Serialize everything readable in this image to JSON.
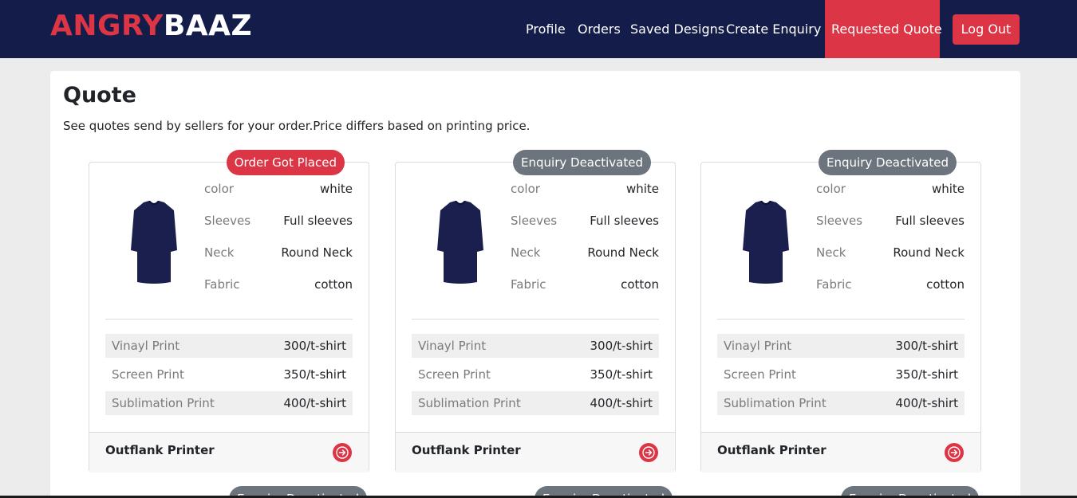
{
  "brand": {
    "part1": "ANGRY",
    "part2": "BAAZ"
  },
  "nav": {
    "profile": "Profile",
    "orders": "Orders",
    "saved_designs": "Saved Designs",
    "create_enquiry": "Create Enquiry",
    "requested_quote": "Requested Quote",
    "logout": "Log Out"
  },
  "page": {
    "title": "Quote",
    "subtitle": "See quotes send by sellers for your order.Price differs based on printing price."
  },
  "colors": {
    "navbar": "#141d4a",
    "accent": "#dc3545",
    "badge_gray": "#6c757d"
  },
  "cards": [
    {
      "status": "Order Got Placed",
      "status_color": "#dc3545",
      "specs": [
        {
          "label": "color",
          "value": "white"
        },
        {
          "label": "Sleeves",
          "value": "Full sleeves"
        },
        {
          "label": "Neck",
          "value": "Round Neck"
        },
        {
          "label": "Fabric",
          "value": "cotton"
        }
      ],
      "prices": [
        {
          "label": "Vinayl Print",
          "value": "300/t-shirt"
        },
        {
          "label": "Screen Print",
          "value": "350/t-shirt"
        },
        {
          "label": "Sublimation Print",
          "value": "400/t-shirt"
        }
      ],
      "seller": "Outflank Printer"
    },
    {
      "status": "Enquiry Deactivated",
      "status_color": "#6c757d",
      "specs": [
        {
          "label": "color",
          "value": "white"
        },
        {
          "label": "Sleeves",
          "value": "Full sleeves"
        },
        {
          "label": "Neck",
          "value": "Round Neck"
        },
        {
          "label": "Fabric",
          "value": "cotton"
        }
      ],
      "prices": [
        {
          "label": "Vinayl Print",
          "value": "300/t-shirt"
        },
        {
          "label": "Screen Print",
          "value": "350/t-shirt"
        },
        {
          "label": "Sublimation Print",
          "value": "400/t-shirt"
        }
      ],
      "seller": "Outflank Printer"
    },
    {
      "status": "Enquiry Deactivated",
      "status_color": "#6c757d",
      "specs": [
        {
          "label": "color",
          "value": "white"
        },
        {
          "label": "Sleeves",
          "value": "Full sleeves"
        },
        {
          "label": "Neck",
          "value": "Round Neck"
        },
        {
          "label": "Fabric",
          "value": "cotton"
        }
      ],
      "prices": [
        {
          "label": "Vinayl Print",
          "value": "300/t-shirt"
        },
        {
          "label": "Screen Print",
          "value": "350/t-shirt"
        },
        {
          "label": "Sublimation Print",
          "value": "400/t-shirt"
        }
      ],
      "seller": "Outflank Printer"
    }
  ],
  "next_row_badges": [
    "Enquiry Deactivated",
    "Enquiry Deactivated",
    "Enquiry Deactivated"
  ]
}
